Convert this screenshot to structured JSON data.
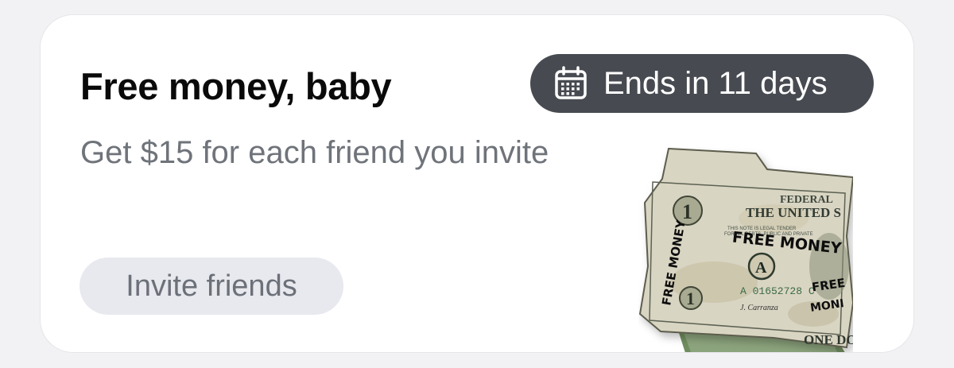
{
  "promo_card": {
    "title": "Free money, baby",
    "subtitle": "Get $15 for each friend you invite",
    "badge": {
      "icon": "calendar-icon",
      "label": "Ends in 11 days"
    },
    "invite_button_label": "Invite friends",
    "illustration": {
      "icon": "dollar-bill-illustration",
      "text_lines": [
        "FEDERAL",
        "THE UNITED S",
        "FREE MONEY",
        "FREE MONEY",
        "FREE MONI",
        "A 01652728 C",
        "A",
        "ONE DO"
      ]
    }
  },
  "colors": {
    "page_background": "#f2f2f4",
    "card_background": "#ffffff",
    "title_text": "#0a0a0a",
    "subtitle_text": "#6f737a",
    "badge_background": "#474b51",
    "badge_text": "#ffffff",
    "button_background": "#e7e9ee",
    "button_text": "#6c7079"
  }
}
